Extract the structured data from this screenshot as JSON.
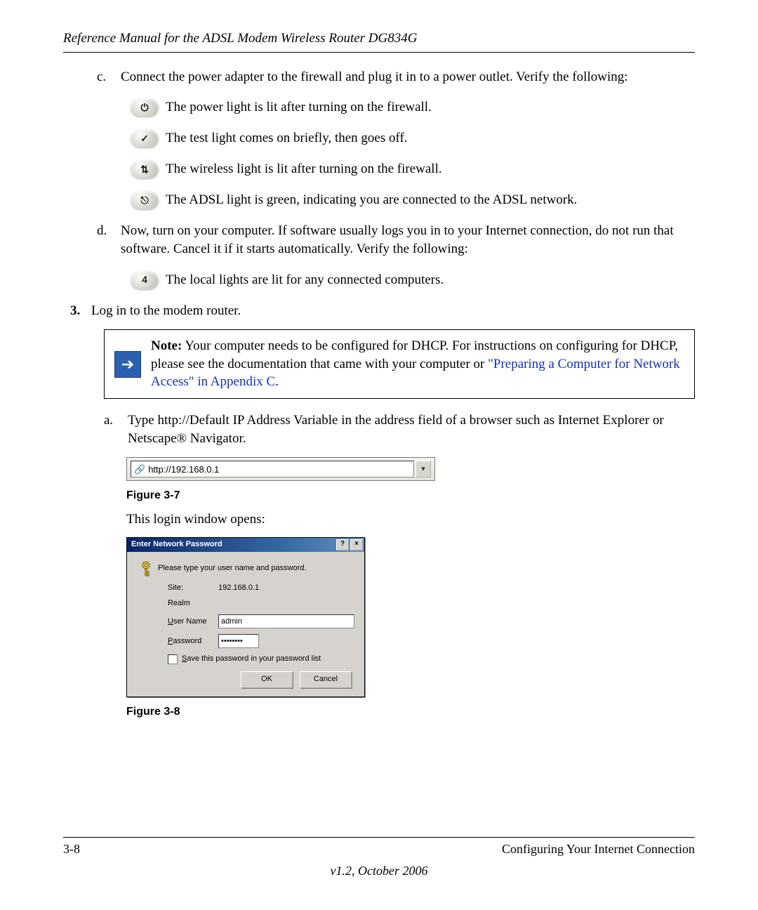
{
  "header": {
    "title": "Reference Manual for the ADSL Modem Wireless Router DG834G"
  },
  "item_c": {
    "label": "c.",
    "text": "Connect the power adapter to the firewall and plug it in to a power outlet. Verify the following:"
  },
  "icons": {
    "power": {
      "glyph": "⏻",
      "text": "The power light is lit after turning on the firewall."
    },
    "test": {
      "glyph": "✓",
      "text": "The test light comes on briefly, then goes off."
    },
    "wireless": {
      "glyph": "⇅",
      "text": "The wireless light is lit after turning on the firewall."
    },
    "adsl": {
      "glyph": "⎋",
      "text": "The ADSL light is green, indicating you are connected to the ADSL network."
    },
    "local": {
      "glyph": "4",
      "text": "The local lights are lit for any connected computers."
    }
  },
  "item_d": {
    "label": "d.",
    "text": "Now, turn on your computer. If software usually logs you in to your Internet connection, do not run that software. Cancel it if it starts automatically. Verify the following:"
  },
  "step3": {
    "label": "3.",
    "text": "Log in to the modem router."
  },
  "note": {
    "bold": "Note:",
    "body": " Your computer needs to be configured for DHCP. For instructions on configuring for DHCP, please see the documentation that came with your computer or ",
    "link": "\"Preparing a Computer for Network Access\" in Appendix C",
    "tail": "."
  },
  "item_a": {
    "label": "a.",
    "text": "Type http://Default IP Address Variable in the address field of a browser such as Internet Explorer or Netscape® Navigator."
  },
  "addressbar": {
    "url": "http://192.168.0.1"
  },
  "fig7": {
    "label": "Figure 3-7"
  },
  "after_fig7": "This login window opens:",
  "dialog": {
    "title": "Enter Network Password",
    "help_btn": "?",
    "close_btn": "×",
    "prompt": "Please type your user name and password.",
    "site_label": "Site:",
    "site_value": "192.168.0.1",
    "realm_label": "Realm",
    "user_label_u": "U",
    "user_label_rest": "ser Name",
    "user_value": "admin",
    "pass_label_u": "P",
    "pass_label_rest": "assword",
    "pass_value": "••••••••",
    "save_u": "S",
    "save_rest": "ave this password in your password list",
    "ok": "OK",
    "cancel": "Cancel"
  },
  "fig8": {
    "label": "Figure 3-8"
  },
  "footer": {
    "page": "3-8",
    "section": "Configuring Your Internet Connection",
    "version": "v1.2, October 2006"
  }
}
